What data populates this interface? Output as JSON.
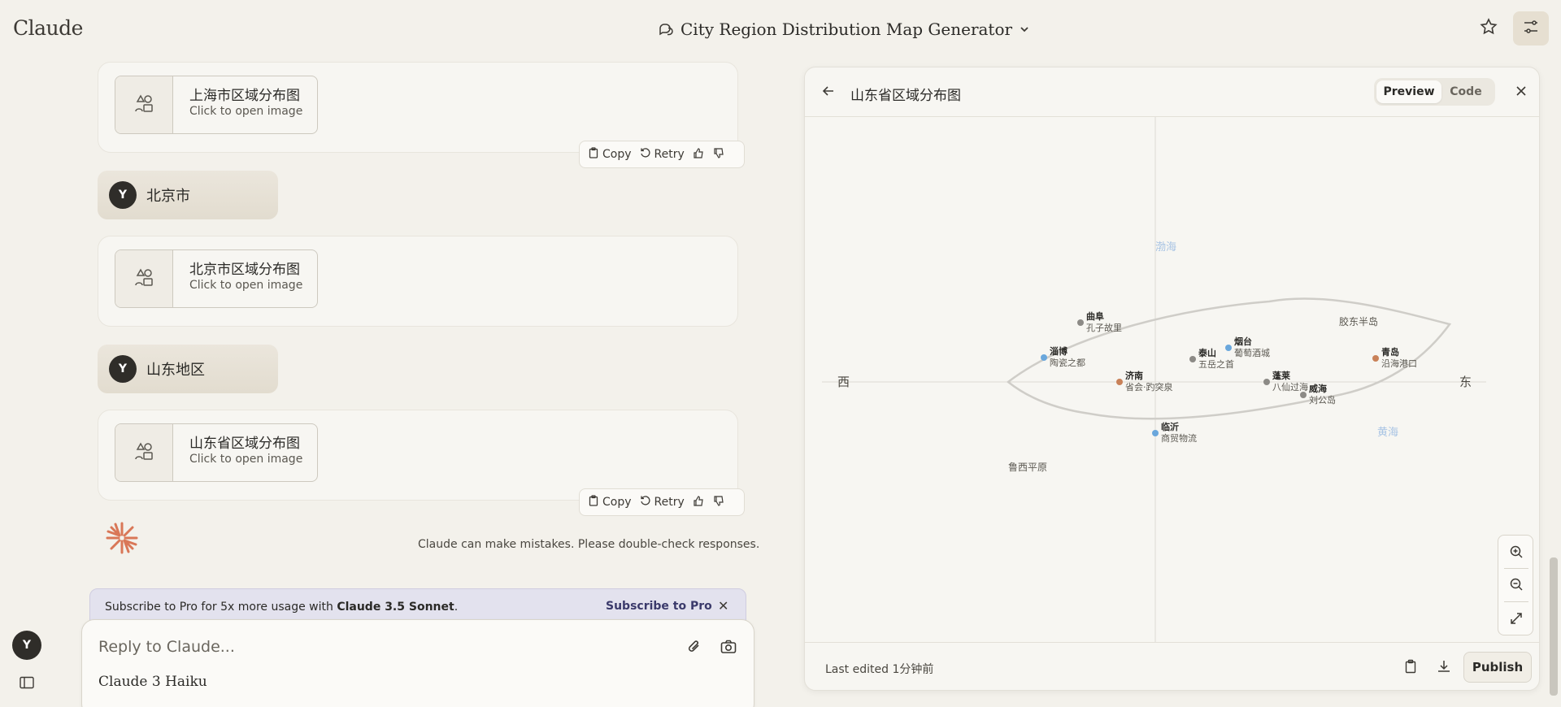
{
  "app": {
    "logo": "Claude"
  },
  "header": {
    "title": "City Region Distribution Map Generator"
  },
  "chat": {
    "messages": [
      {
        "type": "assistant_image",
        "title": "上海市区域分布图",
        "subtitle": "Click to open image"
      },
      {
        "type": "user",
        "avatar": "Y",
        "text": "北京市"
      },
      {
        "type": "assistant_image",
        "title": "北京市区域分布图",
        "subtitle": "Click to open image"
      },
      {
        "type": "user",
        "avatar": "Y",
        "text": "山东地区"
      },
      {
        "type": "assistant_image",
        "title": "山东省区域分布图",
        "subtitle": "Click to open image"
      }
    ],
    "actions": {
      "copy": "Copy",
      "retry": "Retry"
    },
    "disclaimer": "Claude can make mistakes. Please double-check responses."
  },
  "promo": {
    "text_prefix": "Subscribe to Pro for 5x more usage with ",
    "text_bold": "Claude 3.5 Sonnet",
    "text_suffix": ".",
    "cta": "Subscribe to Pro"
  },
  "composer": {
    "placeholder": "Reply to Claude...",
    "model": "Claude 3 Haiku"
  },
  "sidebar": {
    "avatar": "Y"
  },
  "artifact": {
    "title": "山东省区域分布图",
    "tabs": {
      "preview": "Preview",
      "code": "Code"
    },
    "last_edited": "Last edited 1分钟前",
    "publish": "Publish"
  },
  "map": {
    "labels": {
      "west": "西",
      "east": "东",
      "bohai": "渤海",
      "yellow_sea": "黄海",
      "peninsula": "胶东半岛",
      "plain": "鲁西平原"
    },
    "cities": [
      {
        "name": "曲阜",
        "desc": "孔子故里",
        "color": "#8c8a86"
      },
      {
        "name": "淄博",
        "desc": "陶瓷之都",
        "color": "#6aa7dc"
      },
      {
        "name": "济南",
        "desc": "省会·趵突泉",
        "color": "#c98158"
      },
      {
        "name": "泰山",
        "desc": "五岳之首",
        "color": "#8c8a86"
      },
      {
        "name": "烟台",
        "desc": "葡萄酒城",
        "color": "#6aa7dc"
      },
      {
        "name": "蓬莱",
        "desc": "八仙过海",
        "color": "#8c8a86"
      },
      {
        "name": "威海",
        "desc": "刘公岛",
        "color": "#8c8a86"
      },
      {
        "name": "青岛",
        "desc": "沿海港口",
        "color": "#c98158"
      },
      {
        "name": "临沂",
        "desc": "商贸物流",
        "color": "#6aa7dc"
      }
    ]
  }
}
